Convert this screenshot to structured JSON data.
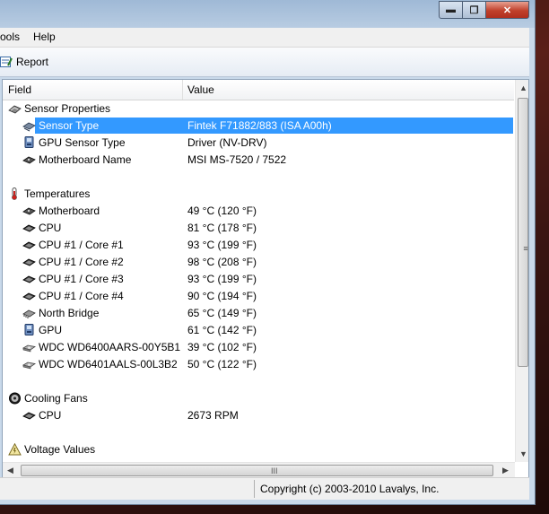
{
  "window": {
    "controls": {
      "minimize": "▬",
      "maximize": "❐",
      "close": "✕"
    }
  },
  "menubar": {
    "items": [
      {
        "label": "ools"
      },
      {
        "label": "Help"
      }
    ]
  },
  "toolbar": {
    "report_label": "Report"
  },
  "columns": {
    "field": "Field",
    "value": "Value"
  },
  "tree": [
    {
      "kind": "group",
      "label": "Sensor Properties",
      "icon": "sensor-properties-icon"
    },
    {
      "kind": "item",
      "label": "Sensor Type",
      "value": "Fintek F71882/883  (ISA A00h)",
      "icon": "sensor-chip-icon",
      "selected": true
    },
    {
      "kind": "item",
      "label": "GPU Sensor Type",
      "value": "Driver  (NV-DRV)",
      "icon": "gpu-icon"
    },
    {
      "kind": "item",
      "label": "Motherboard Name",
      "value": "MSI MS-7520 / 7522",
      "icon": "motherboard-icon"
    },
    {
      "kind": "blank"
    },
    {
      "kind": "group",
      "label": "Temperatures",
      "icon": "thermometer-icon"
    },
    {
      "kind": "item",
      "label": "Motherboard",
      "value": "49 °C  (120 °F)",
      "icon": "motherboard-icon"
    },
    {
      "kind": "item",
      "label": "CPU",
      "value": "81 °C  (178 °F)",
      "icon": "cpu-icon"
    },
    {
      "kind": "item",
      "label": "CPU #1 / Core #1",
      "value": "93 °C  (199 °F)",
      "icon": "cpu-icon"
    },
    {
      "kind": "item",
      "label": "CPU #1 / Core #2",
      "value": "98 °C  (208 °F)",
      "icon": "cpu-icon"
    },
    {
      "kind": "item",
      "label": "CPU #1 / Core #3",
      "value": "93 °C  (199 °F)",
      "icon": "cpu-icon"
    },
    {
      "kind": "item",
      "label": "CPU #1 / Core #4",
      "value": "90 °C  (194 °F)",
      "icon": "cpu-icon"
    },
    {
      "kind": "item",
      "label": "North Bridge",
      "value": "65 °C  (149 °F)",
      "icon": "chip-icon"
    },
    {
      "kind": "item",
      "label": "GPU",
      "value": "61 °C  (142 °F)",
      "icon": "gpu-icon"
    },
    {
      "kind": "item",
      "label": "WDC WD6400AARS-00Y5B1",
      "value": "39 °C  (102 °F)",
      "icon": "hard-drive-icon"
    },
    {
      "kind": "item",
      "label": "WDC WD6401AALS-00L3B2",
      "value": "50 °C  (122 °F)",
      "icon": "hard-drive-icon"
    },
    {
      "kind": "blank"
    },
    {
      "kind": "group",
      "label": "Cooling Fans",
      "icon": "fan-icon"
    },
    {
      "kind": "item",
      "label": "CPU",
      "value": "2673 RPM",
      "icon": "cpu-icon"
    },
    {
      "kind": "blank"
    },
    {
      "kind": "group",
      "label": "Voltage Values",
      "icon": "voltage-warning-icon"
    }
  ],
  "scrollbars": {
    "up": "▲",
    "down": "▼",
    "left": "◀",
    "right": "▶",
    "grip_v": "≡",
    "grip_h": "III"
  },
  "statusbar": {
    "copyright": "Copyright (c) 2003-2010 Lavalys, Inc."
  }
}
